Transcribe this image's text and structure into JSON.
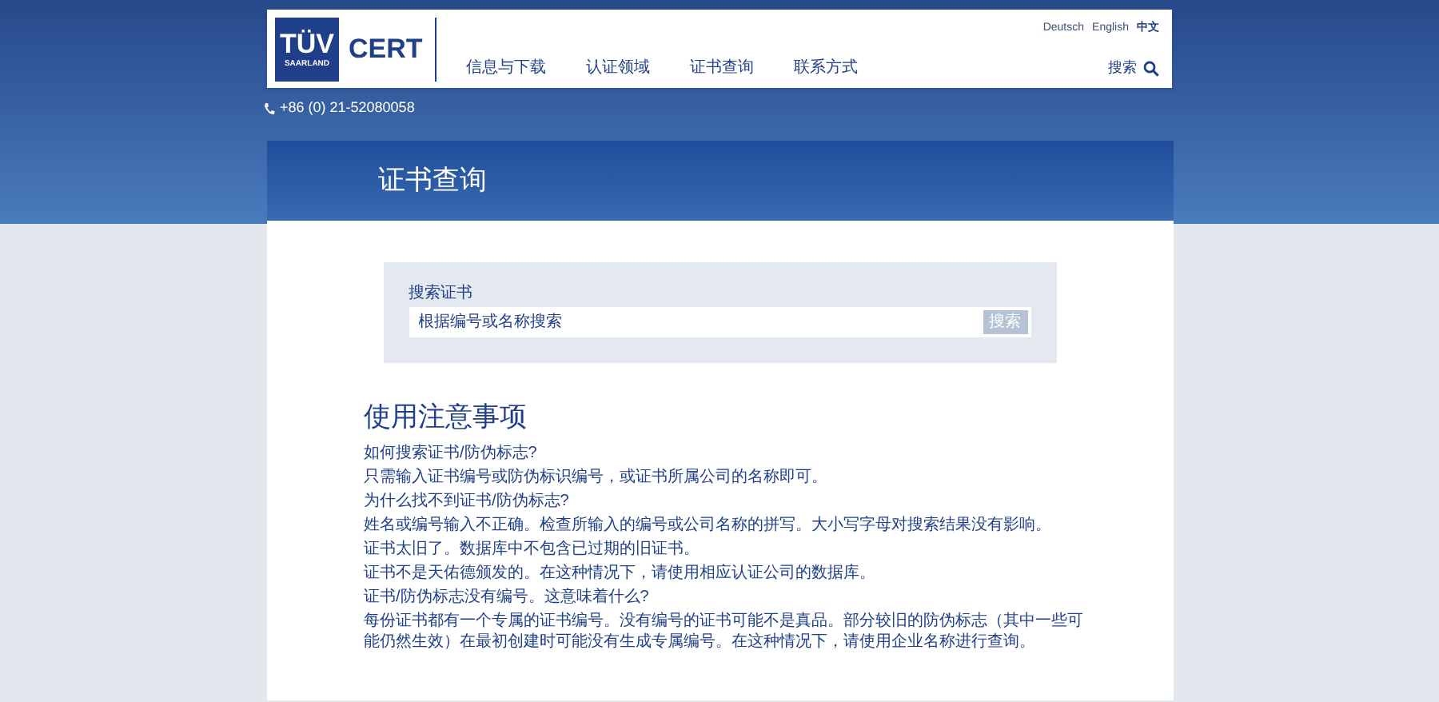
{
  "header": {
    "logo": {
      "brand": "TÜV",
      "sub": "SAARLAND",
      "cert": "CERT"
    },
    "languages": [
      {
        "label": "Deutsch",
        "selected": false
      },
      {
        "label": "English",
        "selected": false
      },
      {
        "label": "中文",
        "selected": true
      }
    ],
    "nav": [
      "信息与下载",
      "认证领域",
      "证书查询",
      "联系方式"
    ],
    "search_label": "搜索"
  },
  "phone": "+86 (0) 21-52080058",
  "page_title": "证书查询",
  "search": {
    "label": "搜索证书",
    "placeholder": "根据编号或名称搜索",
    "button": "搜索"
  },
  "notes": {
    "title": "使用注意事项",
    "paragraphs": [
      "如何搜索证书/防伪标志?",
      "只需输入证书编号或防伪标识编号，或证书所属公司的名称即可。",
      "为什么找不到证书/防伪标志?",
      "姓名或编号输入不正确。检查所输入的编号或公司名称的拼写。大小写字母对搜索结果没有影响。",
      "证书太旧了。数据库中不包含已过期的旧证书。",
      "证书不是天佑德颁发的。在这种情况下，请使用相应认证公司的数据库。",
      "证书/防伪标志没有编号。这意味着什么?",
      "每份证书都有一个专属的证书编号。没有编号的证书可能不是真品。部分较旧的防伪标志（其中一些可能仍然生效）在最初创建时可能没有生成专属编号。在这种情况下，请使用企业名称进行查询。"
    ]
  }
}
